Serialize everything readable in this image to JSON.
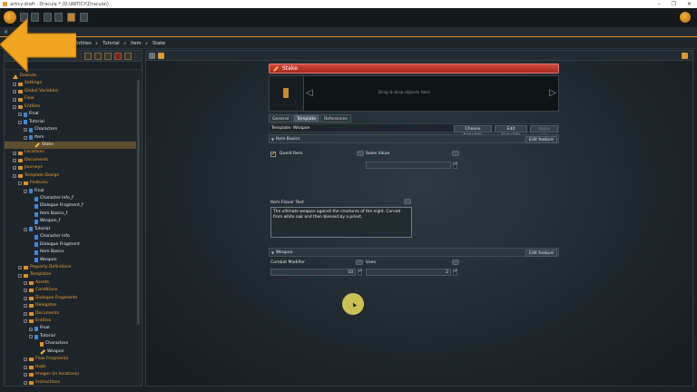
{
  "window": {
    "title": "articy:draft - Dracula * (D:\\ARTICY\\Dracula\\)",
    "controls": [
      "–",
      "❐",
      "✕"
    ]
  },
  "breadcrumb": [
    "Entities",
    "Tutorial",
    "Item",
    "Stake"
  ],
  "tree": [
    {
      "label": "Dracula",
      "indent": 0,
      "color": "orange",
      "icon": "root",
      "exp": ""
    },
    {
      "label": "Settings",
      "indent": 1,
      "color": "orange",
      "icon": "folder",
      "exp": "+"
    },
    {
      "label": "Global Variables",
      "indent": 1,
      "color": "orange",
      "icon": "folder",
      "exp": "+"
    },
    {
      "label": "Flow",
      "indent": 1,
      "color": "orange",
      "icon": "folder",
      "exp": "+"
    },
    {
      "label": "Entities",
      "indent": 1,
      "color": "orange",
      "icon": "folder",
      "exp": "−"
    },
    {
      "label": "Final",
      "indent": 2,
      "color": "white",
      "icon": "blue",
      "exp": "+"
    },
    {
      "label": "Tutorial",
      "indent": 2,
      "color": "white",
      "icon": "blue",
      "exp": "−"
    },
    {
      "label": "Characters",
      "indent": 3,
      "color": "white",
      "icon": "blue",
      "exp": "+"
    },
    {
      "label": "Item",
      "indent": 3,
      "color": "white",
      "icon": "blue",
      "exp": "−"
    },
    {
      "label": "Stake",
      "indent": 4,
      "color": "white",
      "icon": "pencil",
      "exp": "",
      "selected": true
    },
    {
      "label": "Locations",
      "indent": 1,
      "color": "orange",
      "icon": "folder",
      "exp": "+"
    },
    {
      "label": "Documents",
      "indent": 1,
      "color": "orange",
      "icon": "folder",
      "exp": "+"
    },
    {
      "label": "Journeys",
      "indent": 1,
      "color": "orange",
      "icon": "folder",
      "exp": "+"
    },
    {
      "label": "Template Design",
      "indent": 1,
      "color": "orange",
      "icon": "folder",
      "exp": "−"
    },
    {
      "label": "Features",
      "indent": 2,
      "color": "orange",
      "icon": "folder",
      "exp": "−"
    },
    {
      "label": "Final",
      "indent": 3,
      "color": "white",
      "icon": "blue",
      "exp": "−"
    },
    {
      "label": "Character Info_f",
      "indent": 4,
      "color": "white",
      "icon": "blue",
      "exp": ""
    },
    {
      "label": "Dialogue Fragment_f",
      "indent": 4,
      "color": "white",
      "icon": "blue",
      "exp": ""
    },
    {
      "label": "Item Basics_f",
      "indent": 4,
      "color": "white",
      "icon": "blue",
      "exp": ""
    },
    {
      "label": "Weapon_f",
      "indent": 4,
      "color": "white",
      "icon": "blue",
      "exp": ""
    },
    {
      "label": "Tutorial",
      "indent": 3,
      "color": "white",
      "icon": "blue",
      "exp": "−"
    },
    {
      "label": "Character Info",
      "indent": 4,
      "color": "white",
      "icon": "blue",
      "exp": ""
    },
    {
      "label": "Dialogue Fragment",
      "indent": 4,
      "color": "white",
      "icon": "blue",
      "exp": ""
    },
    {
      "label": "Item Basics",
      "indent": 4,
      "color": "white",
      "icon": "blue",
      "exp": ""
    },
    {
      "label": "Weapon",
      "indent": 4,
      "color": "white",
      "icon": "blue",
      "exp": ""
    },
    {
      "label": "Property Definitions",
      "indent": 2,
      "color": "orange",
      "icon": "folder",
      "exp": "+"
    },
    {
      "label": "Templates",
      "indent": 2,
      "color": "orange",
      "icon": "folder",
      "exp": "−"
    },
    {
      "label": "Assets",
      "indent": 3,
      "color": "orange",
      "icon": "folder",
      "exp": "+"
    },
    {
      "label": "Conditions",
      "indent": 3,
      "color": "orange",
      "icon": "folder",
      "exp": "+"
    },
    {
      "label": "Dialogue Fragments",
      "indent": 3,
      "color": "orange",
      "icon": "folder",
      "exp": "+"
    },
    {
      "label": "Delegates",
      "indent": 3,
      "color": "orange",
      "icon": "folder",
      "exp": "+"
    },
    {
      "label": "Documents",
      "indent": 3,
      "color": "orange",
      "icon": "folder",
      "exp": "+"
    },
    {
      "label": "Entities",
      "indent": 3,
      "color": "orange",
      "icon": "folder",
      "exp": "−"
    },
    {
      "label": "Final",
      "indent": 4,
      "color": "white",
      "icon": "blue",
      "exp": "+"
    },
    {
      "label": "Tutorial",
      "indent": 4,
      "color": "white",
      "icon": "blue",
      "exp": "−"
    },
    {
      "label": "Characters",
      "indent": 5,
      "color": "white",
      "icon": "orange",
      "exp": ""
    },
    {
      "label": "Weapon",
      "indent": 5,
      "color": "white",
      "icon": "pencil",
      "exp": ""
    },
    {
      "label": "Flow Fragments",
      "indent": 3,
      "color": "orange",
      "icon": "folder",
      "exp": "+"
    },
    {
      "label": "Hubs",
      "indent": 3,
      "color": "orange",
      "icon": "folder",
      "exp": "+"
    },
    {
      "label": "Images (in locations)",
      "indent": 3,
      "color": "orange",
      "icon": "folder",
      "exp": "+"
    },
    {
      "label": "Instructions",
      "indent": 3,
      "color": "orange",
      "icon": "folder",
      "exp": "+"
    }
  ],
  "editor": {
    "object_title": "Stake",
    "dropzone_hint": "Drag & drop objects here",
    "tabs": [
      "General",
      "Template",
      "References"
    ],
    "active_tab": "Template",
    "template_label": "Template: Weapon",
    "buttons": {
      "choose": "Choose template",
      "edit": "Edit template",
      "apply": "Apply color"
    },
    "item_basics": {
      "header": "Item Basics",
      "edit_feature": "Edit feature",
      "quest_item_label": "Quest Item",
      "quest_item_checked": true,
      "quest_item_mark": "✔",
      "sales_value_label": "Sales Value",
      "flavor_label": "Item Flavor Text",
      "flavor_text": "The ultimate weapon against the creatures of the night. Carved from white oak and then blessed by a priest."
    },
    "weapon": {
      "header": "Weapon",
      "edit_feature": "Edit feature",
      "combat_label": "Combat Modifier",
      "combat_value": "10",
      "uses_label": "Uses",
      "uses_value": "2"
    }
  },
  "colors": {
    "accent": "#e29a22",
    "title_bar": "#c0392b",
    "panel": "#1e252a"
  }
}
